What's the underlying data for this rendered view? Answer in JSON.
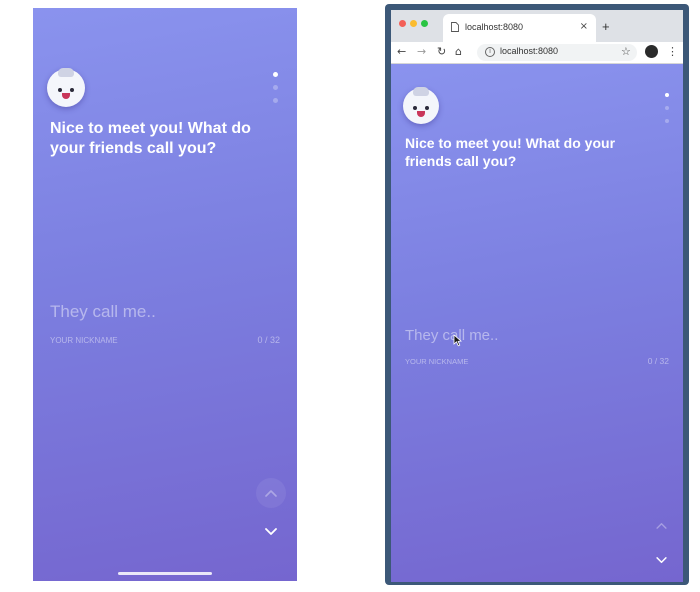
{
  "onboarding": {
    "question": "Nice to meet you! What do your friends call you?",
    "answer_placeholder": "They call me..",
    "answer_value": "",
    "hint": "YOUR NICKNAME",
    "counter": "0 / 32",
    "steps_total": 3,
    "active_step": 1
  },
  "icons": {
    "avatar": "robot-avatar-icon",
    "previous": "chevron-up-icon",
    "next": "chevron-down-icon"
  },
  "browser": {
    "tab_title": "localhost:8080",
    "url": "localhost:8080",
    "tab_close": "×",
    "new_tab": "+"
  },
  "colors": {
    "gradient_top": "#8a93ee",
    "gradient_bottom": "#7566cf",
    "close_light": "#f35f57",
    "minimize_light": "#fbbc2f",
    "maximize_light": "#29c443"
  }
}
